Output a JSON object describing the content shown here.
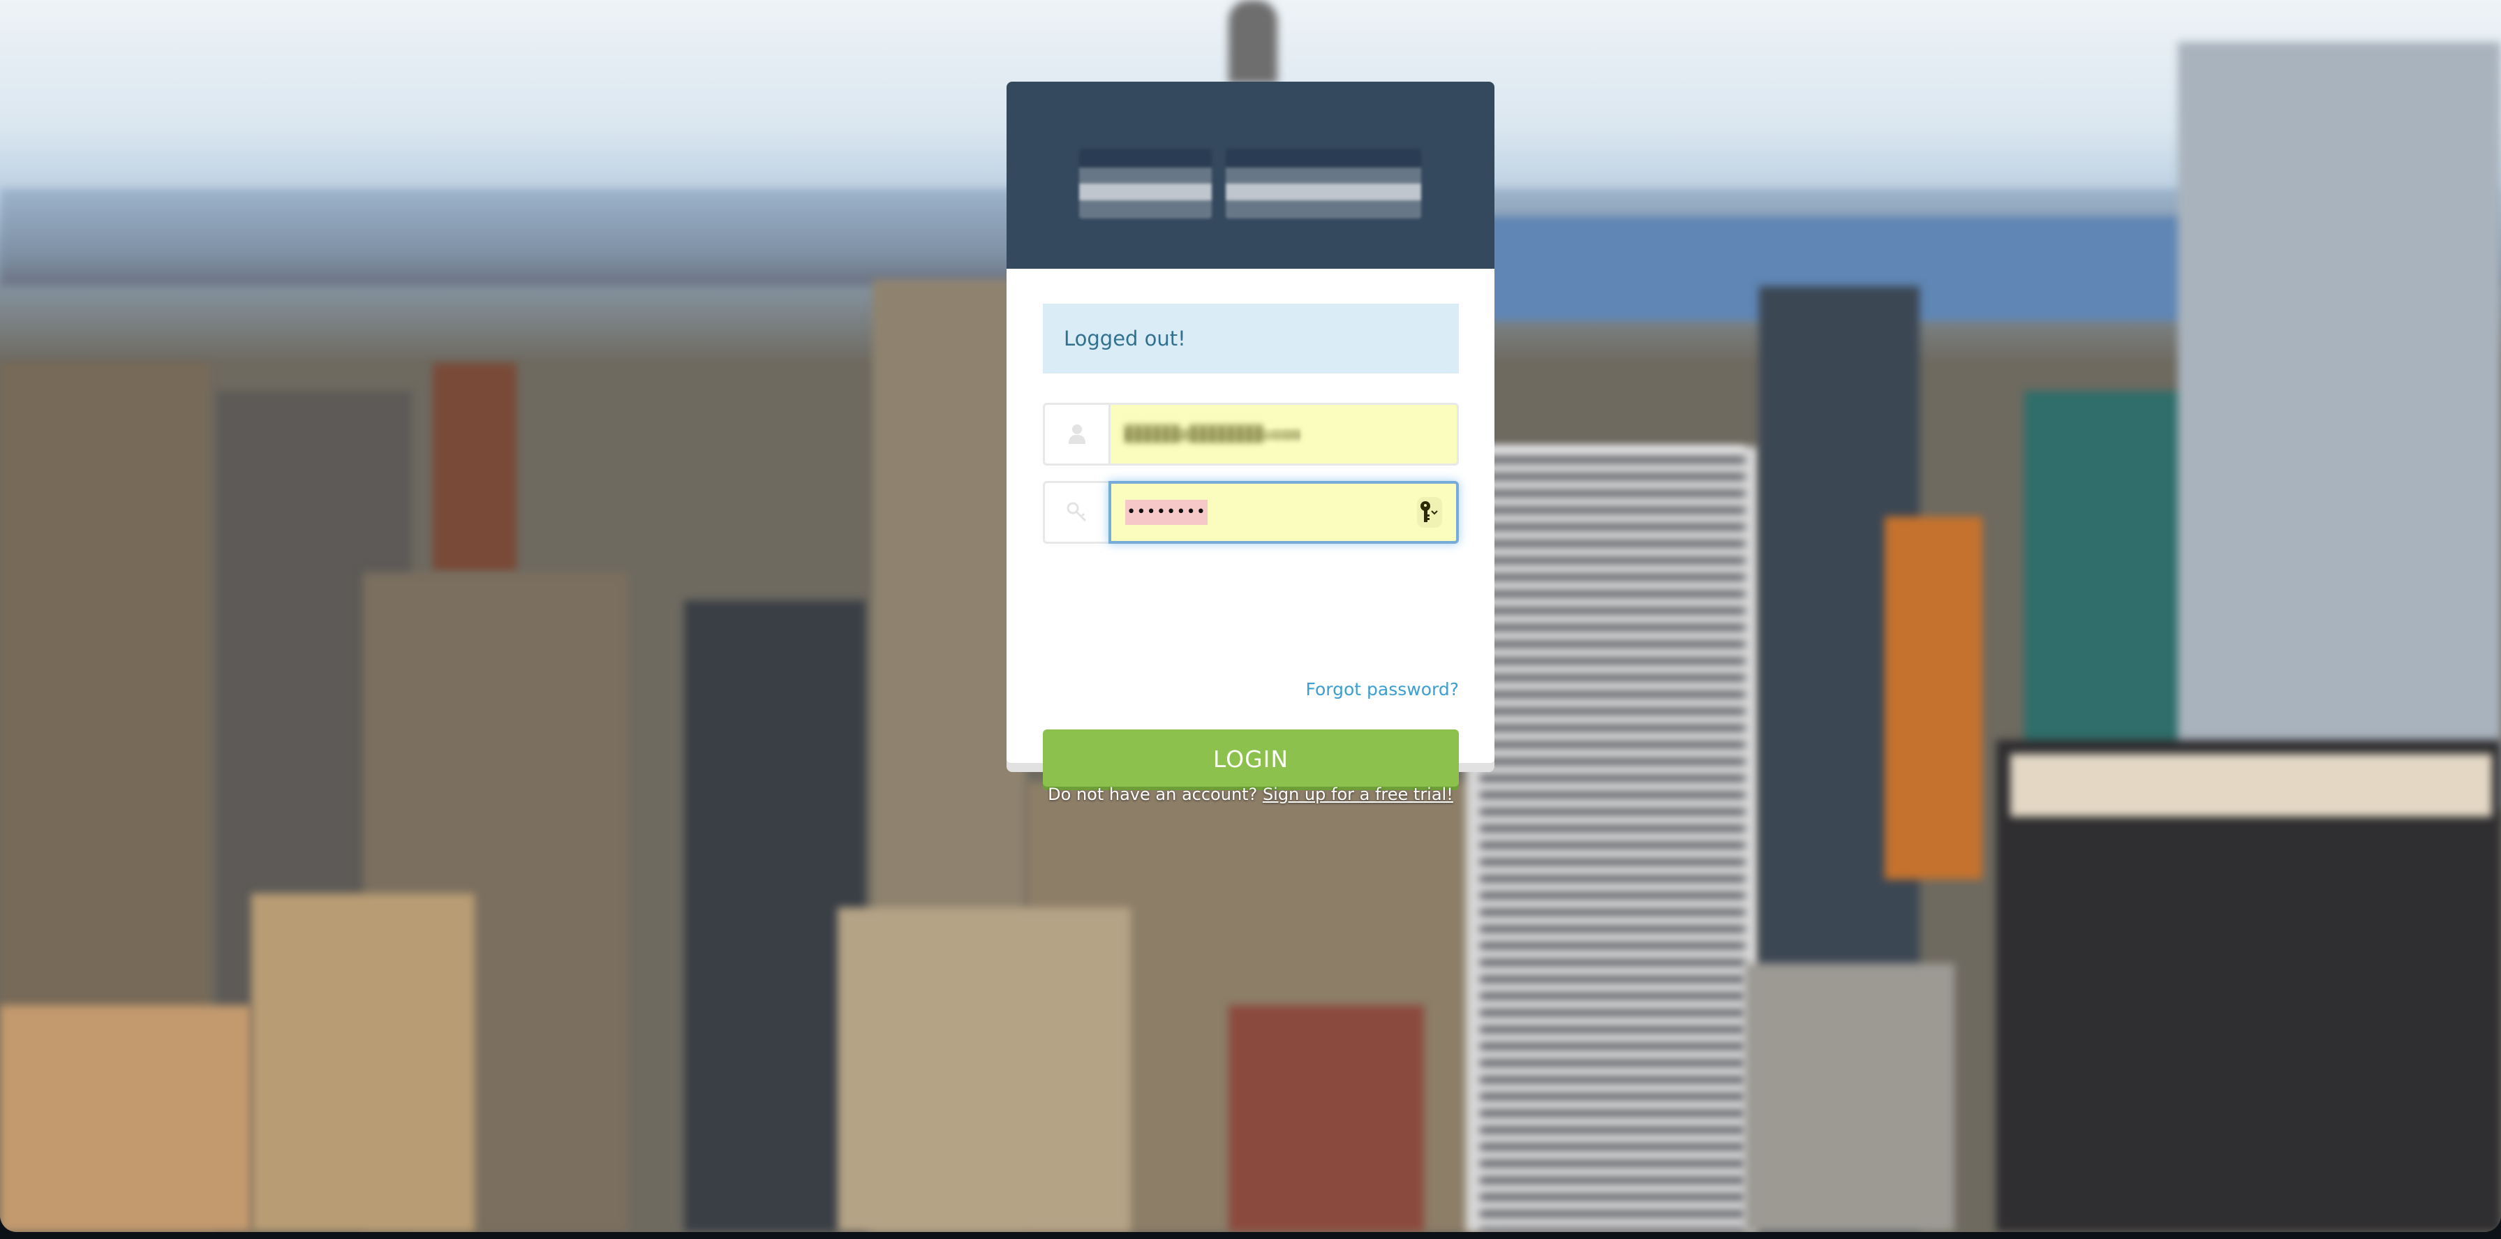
{
  "page": {
    "background": "blurred aerial city skyline photograph"
  },
  "header": {
    "logo_alt": "Company logo (pixelated)"
  },
  "alert": {
    "message": "Logged out!",
    "color": "#31708f",
    "background": "#daedf7"
  },
  "form": {
    "email": {
      "icon": "user-icon",
      "value": "system@company.com (pixelated)",
      "display_value": "██████@████████.com"
    },
    "password": {
      "icon": "key-icon",
      "value": "••••••••",
      "password_manager_icon": "key-dropdown-icon"
    },
    "forgot_label": "Forgot password?",
    "login_label": "LOGIN",
    "login_color": "#8bc14c"
  },
  "footer": {
    "prompt": "Do not have an account?",
    "signup_label": "Sign up for a free trial!"
  }
}
